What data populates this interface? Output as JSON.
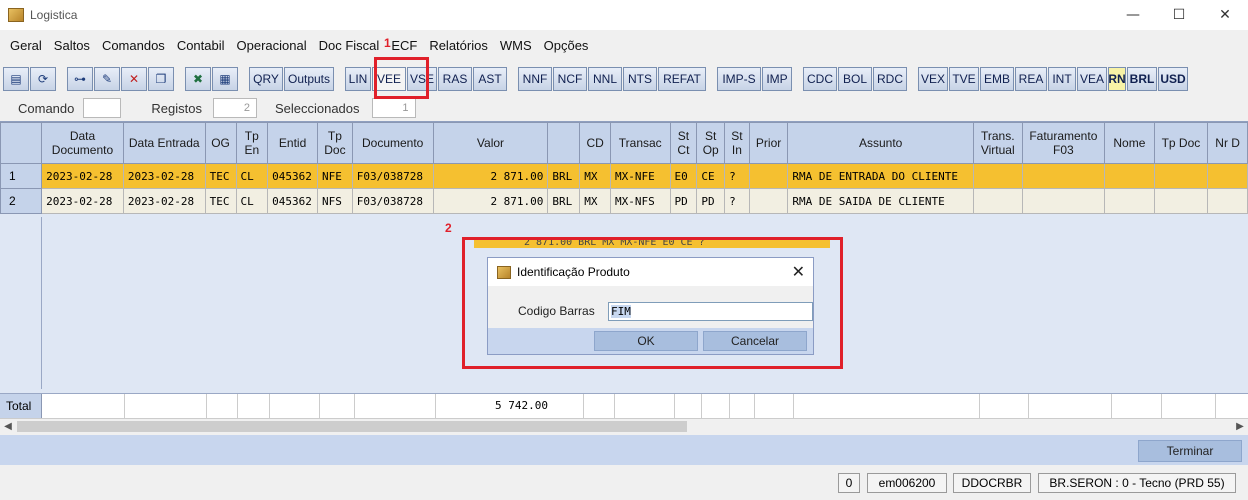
{
  "window": {
    "title": "Logistica",
    "controls": [
      "—",
      "☐",
      "✕"
    ]
  },
  "menu": [
    "Geral",
    "Saltos",
    "Comandos",
    "Contabil",
    "Operacional",
    "Doc Fiscal",
    "ECF",
    "Relatórios",
    "WMS",
    "Opções"
  ],
  "toolbar": {
    "icons": [
      "list-icon",
      "refresh-icon",
      "glasses-icon",
      "edit-icon",
      "delete-icon",
      "copy-icon",
      "excel-icon",
      "document-icon"
    ],
    "buttons": [
      "QRY",
      "Outputs",
      "LIN",
      "VEE",
      "VSE",
      "RAS",
      "AST",
      "NNF",
      "NCF",
      "NNL",
      "NTS",
      "REFAT",
      "IMP-S",
      "IMP",
      "CDC",
      "BOL",
      "RDC",
      "VEX",
      "TVE",
      "EMB",
      "REA",
      "INT",
      "VEA",
      "RN",
      "BRL",
      "USD"
    ]
  },
  "infobar": {
    "comando_label": "Comando",
    "comando_value": "",
    "registos_label": "Registos",
    "registos_value": "2",
    "seleccionados_label": "Seleccionados",
    "seleccionados_value": "1"
  },
  "grid": {
    "columns": [
      "",
      "Data Documento",
      "Data Entrada",
      "OG",
      "Tp En",
      "Entid",
      "Tp Doc",
      "Documento",
      "Valor",
      "",
      "CD",
      "Transac",
      "St Ct",
      "St Op",
      "St In",
      "Prior",
      "Assunto",
      "Trans. Virtual",
      "Faturamento F03",
      "Nome",
      "Tp Doc",
      "Nr D"
    ],
    "rows": [
      {
        "n": "1",
        "data_doc": "2023-02-28",
        "data_ent": "2023-02-28",
        "og": "TEC",
        "tpen": "CL",
        "entid": "045362",
        "tpdoc": "NFE",
        "documento": "F03/038728",
        "valor": "2 871.00",
        "moeda": "BRL",
        "cd": "MX",
        "transac": "MX-NFE",
        "stct": "E0",
        "stop": "CE",
        "stin": "?",
        "prior": "",
        "assunto": "RMA DE ENTRADA DO CLIENTE"
      },
      {
        "n": "2",
        "data_doc": "2023-02-28",
        "data_ent": "2023-02-28",
        "og": "TEC",
        "tpen": "CL",
        "entid": "045362",
        "tpdoc": "NFS",
        "documento": "F03/038728",
        "valor": "2 871.00",
        "moeda": "BRL",
        "cd": "MX",
        "transac": "MX-NFS",
        "stct": "PD",
        "stop": "PD",
        "stin": "?",
        "prior": "",
        "assunto": "RMA DE SAIDA DE CLIENTE"
      }
    ],
    "total_label": "Total",
    "total_value": "5 742.00"
  },
  "background_row_fragment": "2 871.00  BRL  MX  MX-NFE  E0  CE  ?",
  "annotations": {
    "marker1": "1",
    "marker2": "2"
  },
  "dialog": {
    "title": "Identificação Produto",
    "close": "✕",
    "field_label": "Codigo Barras",
    "field_value": "FIM",
    "ok_label": "OK",
    "cancel_label": "Cancelar"
  },
  "footer": {
    "terminar_label": "Terminar"
  },
  "status": {
    "count": "0",
    "user": "em006200",
    "code": "DDOCRBR",
    "env": "BR.SERON : 0 - Tecno (PRD 55)"
  },
  "colors": {
    "selected_row": "#f5c030",
    "header": "#c5d3ea",
    "annotation_red": "#e0202a"
  }
}
